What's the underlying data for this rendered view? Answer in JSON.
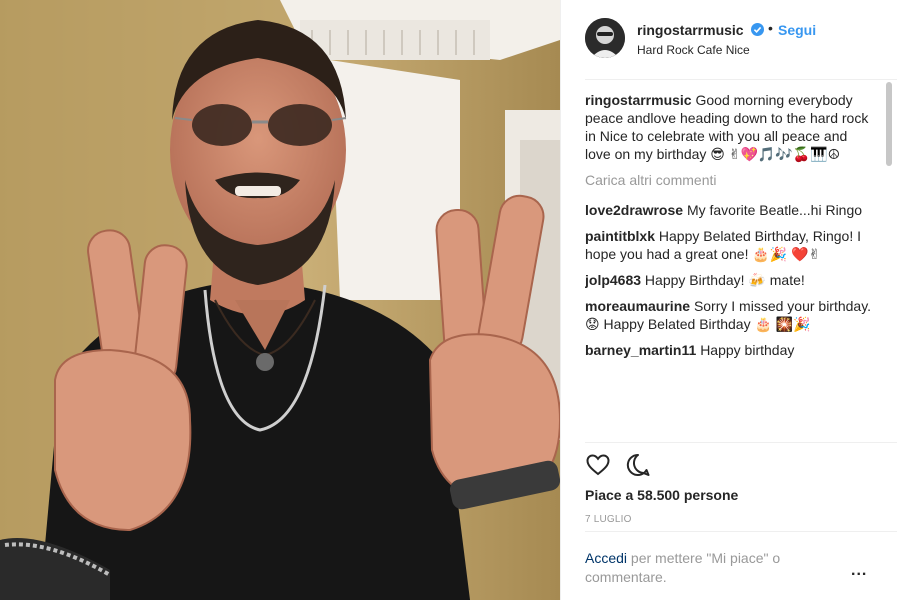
{
  "post": {
    "username": "ringostarrmusic",
    "location": "Hard Rock Cafe Nice",
    "follow_label": "Segui",
    "separator": "•",
    "caption": {
      "user": "ringostarrmusic",
      "text": "Good morning everybody peace andlove heading down to the hard rock in Nice to celebrate with you all peace and love on my birthday 😎 ✌💖🎵🎶🍒🎹☮"
    },
    "load_more_label": "Carica altri commenti",
    "comments": [
      {
        "user": "love2drawrose",
        "text": "My favorite Beatle...hi Ringo"
      },
      {
        "user": "paintitblxk",
        "text": "Happy Belated Birthday, Ringo! I hope you had a great one! 🎂🎉 ❤️✌"
      },
      {
        "user": "jolp4683",
        "text": "Happy Birthday! 🍻 mate!"
      },
      {
        "user": "moreaumaurine",
        "text": "Sorry I missed your birthday. 😟 Happy Belated Birthday 🎂 🎇🎉"
      },
      {
        "user": "barney_martin11",
        "text": "Happy birthday"
      }
    ],
    "likes_text": "Piace a 58.500 persone",
    "date": "7 LUGLIO",
    "login_link": "Accedi",
    "login_text": " per mettere \"Mi piace\" o commentare.",
    "more_label": "..."
  },
  "icons": {
    "like": "heart-outline-icon",
    "comment": "speech-bubble-icon",
    "verified": "verified-badge-icon"
  },
  "colors": {
    "link_blue": "#3897f0",
    "login_link": "#003569",
    "muted": "#999999",
    "text": "#262626"
  }
}
